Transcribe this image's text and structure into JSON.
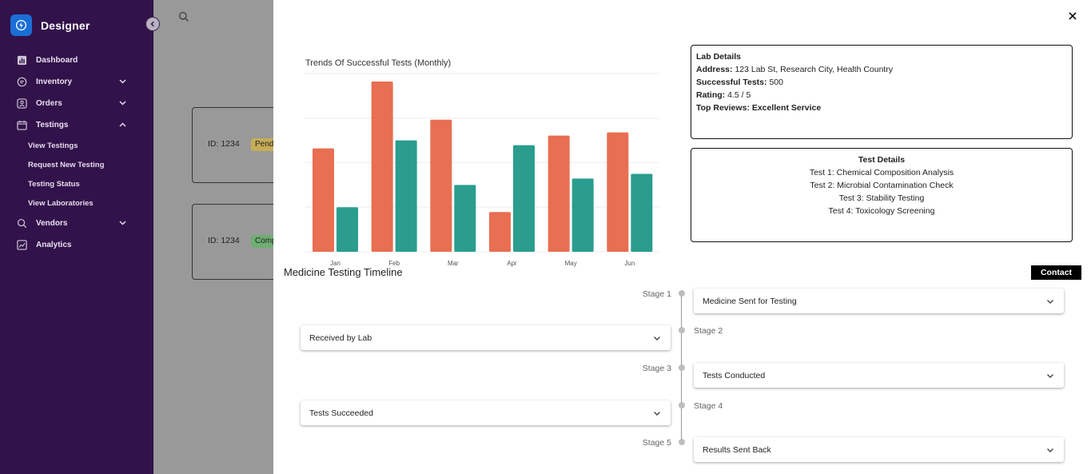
{
  "sidebar": {
    "brand": "Designer",
    "items": [
      {
        "label": "Dashboard",
        "icon": "dashboard-icon"
      },
      {
        "label": "Inventory",
        "icon": "inventory-icon"
      },
      {
        "label": "Orders",
        "icon": "orders-icon"
      },
      {
        "label": "Testings",
        "icon": "testings-icon"
      },
      {
        "label": "Vendors",
        "icon": "vendors-icon"
      },
      {
        "label": "Analytics",
        "icon": "analytics-icon"
      }
    ],
    "testings_sub": [
      "View Testings",
      "Request New Testing",
      "Testing Status",
      "View Laboratories"
    ]
  },
  "background": {
    "cards": [
      {
        "id": "ID: 1234",
        "badge": "Pending",
        "badge_color": "#c7ad57"
      },
      {
        "id": "ID: 1234",
        "badge": "Completed",
        "badge_color": "#6fae73"
      }
    ]
  },
  "lab_details": {
    "heading": "Lab Details",
    "address_label": "Address:",
    "address": "123 Lab St, Research City, Health Country",
    "tests_label": "Successful Tests:",
    "tests": "500",
    "rating_label": "Rating:",
    "rating": "4.5 / 5",
    "reviews_label": "Top Reviews:",
    "reviews": "Excellent Service"
  },
  "test_details": {
    "heading": "Test Details",
    "tests": [
      "Test 1: Chemical Composition Analysis",
      "Test 2: Microbial Contamination Check",
      "Test 3: Stability Testing",
      "Test 4: Toxicology Screening"
    ]
  },
  "timeline": {
    "title": "Medicine Testing Timeline",
    "contact_label": "Contact",
    "stages": [
      {
        "label": "Stage 1",
        "title": "Medicine Sent for Testing"
      },
      {
        "label": "Stage 2",
        "title": "Received by Lab"
      },
      {
        "label": "Stage 3",
        "title": "Tests Conducted"
      },
      {
        "label": "Stage 4",
        "title": "Tests Succeeded"
      },
      {
        "label": "Stage 5",
        "title": "Results Sent Back"
      }
    ]
  },
  "chart_data": {
    "type": "bar",
    "title": "Trends Of Successful Tests (Monthly)",
    "categories": [
      "Jan",
      "Feb",
      "Mar",
      "Apr",
      "May",
      "Jun"
    ],
    "series": [
      {
        "values": [
          65,
          107,
          83,
          25,
          73,
          75
        ],
        "color": "#e86f51"
      },
      {
        "values": [
          28,
          70,
          42,
          67,
          46,
          49
        ],
        "color": "#2a9d8f"
      }
    ],
    "ylim": [
      0,
      112
    ],
    "grid": true
  },
  "colors": {
    "sidebar_bg": "#32124a",
    "brand_blue": "#1a6fd6",
    "modal_bg": "#ffffff"
  }
}
